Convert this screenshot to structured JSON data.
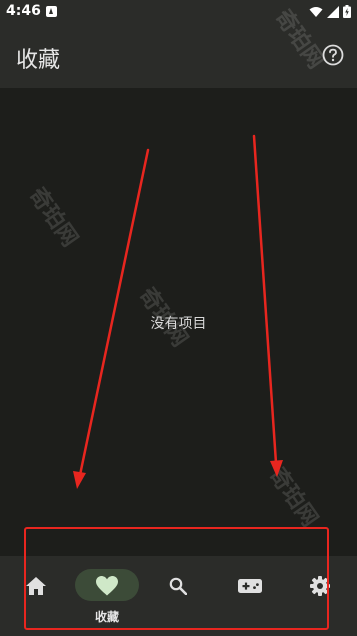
{
  "status_bar": {
    "time": "4:46"
  },
  "app_bar": {
    "title": "收藏",
    "help_icon": "help-circle-icon"
  },
  "content": {
    "empty_message": "没有项目"
  },
  "bottom_nav": {
    "items": [
      {
        "id": "home",
        "icon": "home-icon",
        "label": ""
      },
      {
        "id": "favorites",
        "icon": "heart-icon",
        "label": "收藏",
        "selected": true
      },
      {
        "id": "search",
        "icon": "search-icon",
        "label": ""
      },
      {
        "id": "games",
        "icon": "gamepad-icon",
        "label": ""
      },
      {
        "id": "settings",
        "icon": "gear-icon",
        "label": ""
      }
    ]
  },
  "annotation": {
    "arrow_color": "#e8261f",
    "box_color": "#e8261f"
  },
  "watermark": {
    "text": "奇珀网"
  },
  "colors": {
    "background": "#1d1e1b",
    "bar": "#2b2c29",
    "selected_pill": "#3c4b38",
    "heart": "#cfe8c8"
  }
}
